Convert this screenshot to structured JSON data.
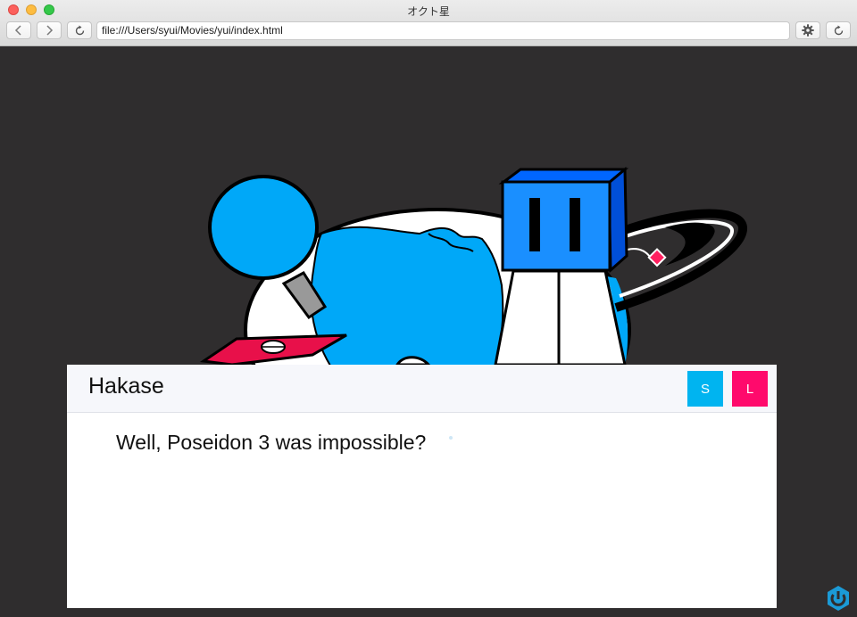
{
  "window": {
    "title": "オクト星"
  },
  "toolbar": {
    "url": "file:///Users/syui/Movies/yui/index.html",
    "back_icon": "chevron-left-icon",
    "forward_icon": "chevron-right-icon",
    "reload_icon": "reload-icon",
    "settings_icon": "gear-icon"
  },
  "dialog": {
    "speaker": "Hakase",
    "text": "Well, Poseidon 3 was impossible?",
    "buttons": {
      "s_label": "S",
      "l_label": "L"
    }
  },
  "colors": {
    "background": "#2f2d2e",
    "planet": "#00a8f8",
    "cube": "#1a8fff",
    "button_s": "#00b4f0",
    "button_l": "#ff0a6c"
  }
}
